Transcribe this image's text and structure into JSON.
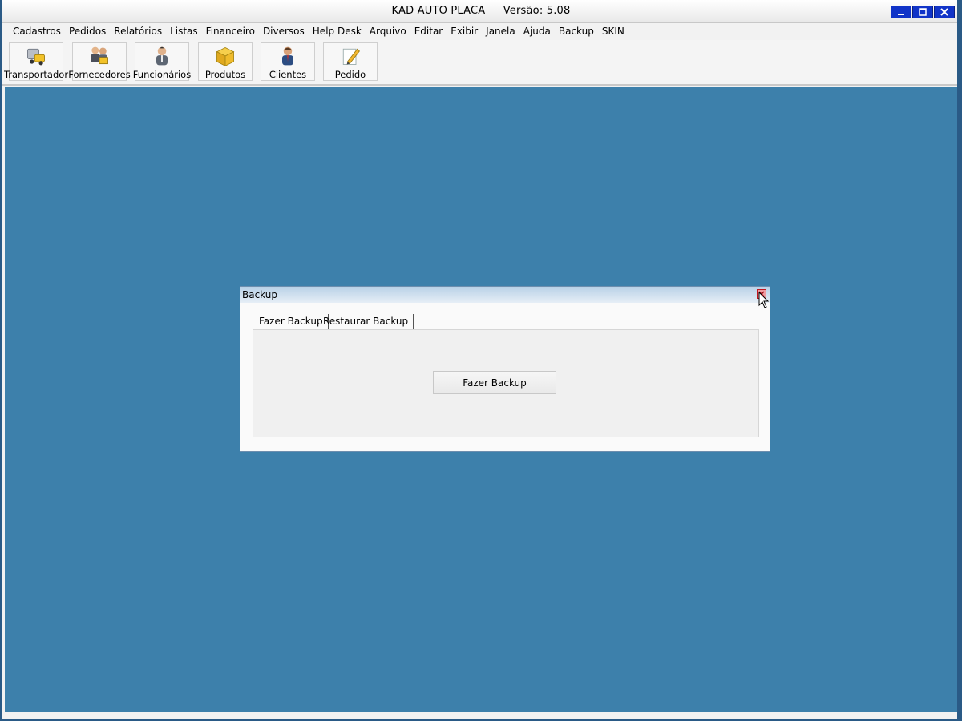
{
  "window": {
    "app_name": "KAD AUTO PLACA",
    "version_label": "Versão: 5.08",
    "minimize_icon": "minimize-icon",
    "maximize_icon": "maximize-icon",
    "close_icon": "close-icon",
    "title_color": "#1134c8"
  },
  "menu": {
    "items": [
      {
        "label": "Cadastros"
      },
      {
        "label": "Pedidos"
      },
      {
        "label": "Relatórios"
      },
      {
        "label": "Listas"
      },
      {
        "label": "Financeiro"
      },
      {
        "label": "Diversos"
      },
      {
        "label": "Help Desk"
      },
      {
        "label": "Arquivo"
      },
      {
        "label": "Editar"
      },
      {
        "label": "Exibir"
      },
      {
        "label": "Janela"
      },
      {
        "label": "Ajuda"
      },
      {
        "label": "Backup"
      },
      {
        "label": "SKIN"
      }
    ]
  },
  "toolbar": {
    "buttons": [
      {
        "label": "Transportador",
        "icon": "truck-icon"
      },
      {
        "label": "Fornecedores",
        "icon": "suppliers-icon"
      },
      {
        "label": "Funcionários",
        "icon": "employee-icon"
      },
      {
        "label": "Produtos",
        "icon": "box-icon"
      },
      {
        "label": "Clientes",
        "icon": "client-icon"
      },
      {
        "label": "Pedido",
        "icon": "pencil-icon"
      }
    ]
  },
  "dialog": {
    "title": "Backup",
    "tabs": [
      {
        "label": "Fazer Backup"
      },
      {
        "label": "Restaurar Backup"
      }
    ],
    "action_button": "Fazer Backup"
  },
  "colors": {
    "workspace": "#3d80ab",
    "dialog_title": "#b9d1e7"
  }
}
